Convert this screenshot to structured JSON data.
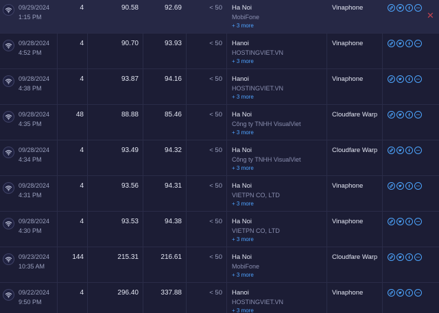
{
  "rows": [
    {
      "date": "09/29/2024",
      "time": "1:15 PM",
      "hops": "4",
      "download": "90.58",
      "upload": "92.69",
      "ping": "< 50",
      "city": "Ha Noi",
      "isp": "MobiFone",
      "more": "+ 3 more",
      "carrier": "Vinaphone"
    },
    {
      "date": "09/28/2024",
      "time": "4:52 PM",
      "hops": "4",
      "download": "90.70",
      "upload": "93.93",
      "ping": "< 50",
      "city": "Hanoi",
      "isp": "HOSTINGVIET.VN",
      "more": "+ 3 more",
      "carrier": "Vinaphone"
    },
    {
      "date": "09/28/2024",
      "time": "4:38 PM",
      "hops": "4",
      "download": "93.87",
      "upload": "94.16",
      "ping": "< 50",
      "city": "Hanoi",
      "isp": "HOSTINGVIET.VN",
      "more": "+ 3 more",
      "carrier": "Vinaphone"
    },
    {
      "date": "09/28/2024",
      "time": "4:35 PM",
      "hops": "48",
      "download": "88.88",
      "upload": "85.46",
      "ping": "< 50",
      "city": "Ha Noi",
      "isp": "Công ty TNHH VisualViet",
      "more": "+ 3 more",
      "carrier": "Cloudfare Warp"
    },
    {
      "date": "09/28/2024",
      "time": "4:34 PM",
      "hops": "4",
      "download": "93.49",
      "upload": "94.32",
      "ping": "< 50",
      "city": "Ha Noi",
      "isp": "Công ty TNHH VisualViet",
      "more": "+ 3 more",
      "carrier": "Cloudfare Warp"
    },
    {
      "date": "09/28/2024",
      "time": "4:31 PM",
      "hops": "4",
      "download": "93.56",
      "upload": "94.31",
      "ping": "< 50",
      "city": "Ha Noi",
      "isp": "VIETPN CO, LTD",
      "more": "+ 3 more",
      "carrier": "Vinaphone"
    },
    {
      "date": "09/28/2024",
      "time": "4:30 PM",
      "hops": "4",
      "download": "93.53",
      "upload": "94.38",
      "ping": "< 50",
      "city": "Ha Noi",
      "isp": "VIETPN CO, LTD",
      "more": "+ 3 more",
      "carrier": "Vinaphone"
    },
    {
      "date": "09/23/2024",
      "time": "10:35 AM",
      "hops": "144",
      "download": "215.31",
      "upload": "216.61",
      "ping": "< 50",
      "city": "Ha Noi",
      "isp": "MobiFone",
      "more": "+ 3 more",
      "carrier": "Cloudfare Warp"
    },
    {
      "date": "09/22/2024",
      "time": "9:50 PM",
      "hops": "4",
      "download": "296.40",
      "upload": "337.88",
      "ping": "< 50",
      "city": "Hanoi",
      "isp": "HOSTINGVIET.VN",
      "more": "+ 3 more",
      "carrier": "Vinaphone"
    }
  ],
  "icons": {
    "connection": "wifi-icon",
    "actions": [
      "link-icon",
      "twitter-icon",
      "facebook-icon",
      "more-icon"
    ],
    "remove": "close-icon"
  },
  "colors": {
    "background": "#1c1d35",
    "highlight_row": "#262845",
    "accent_blue": "#4da6ff",
    "close_red": "#c0424e"
  }
}
